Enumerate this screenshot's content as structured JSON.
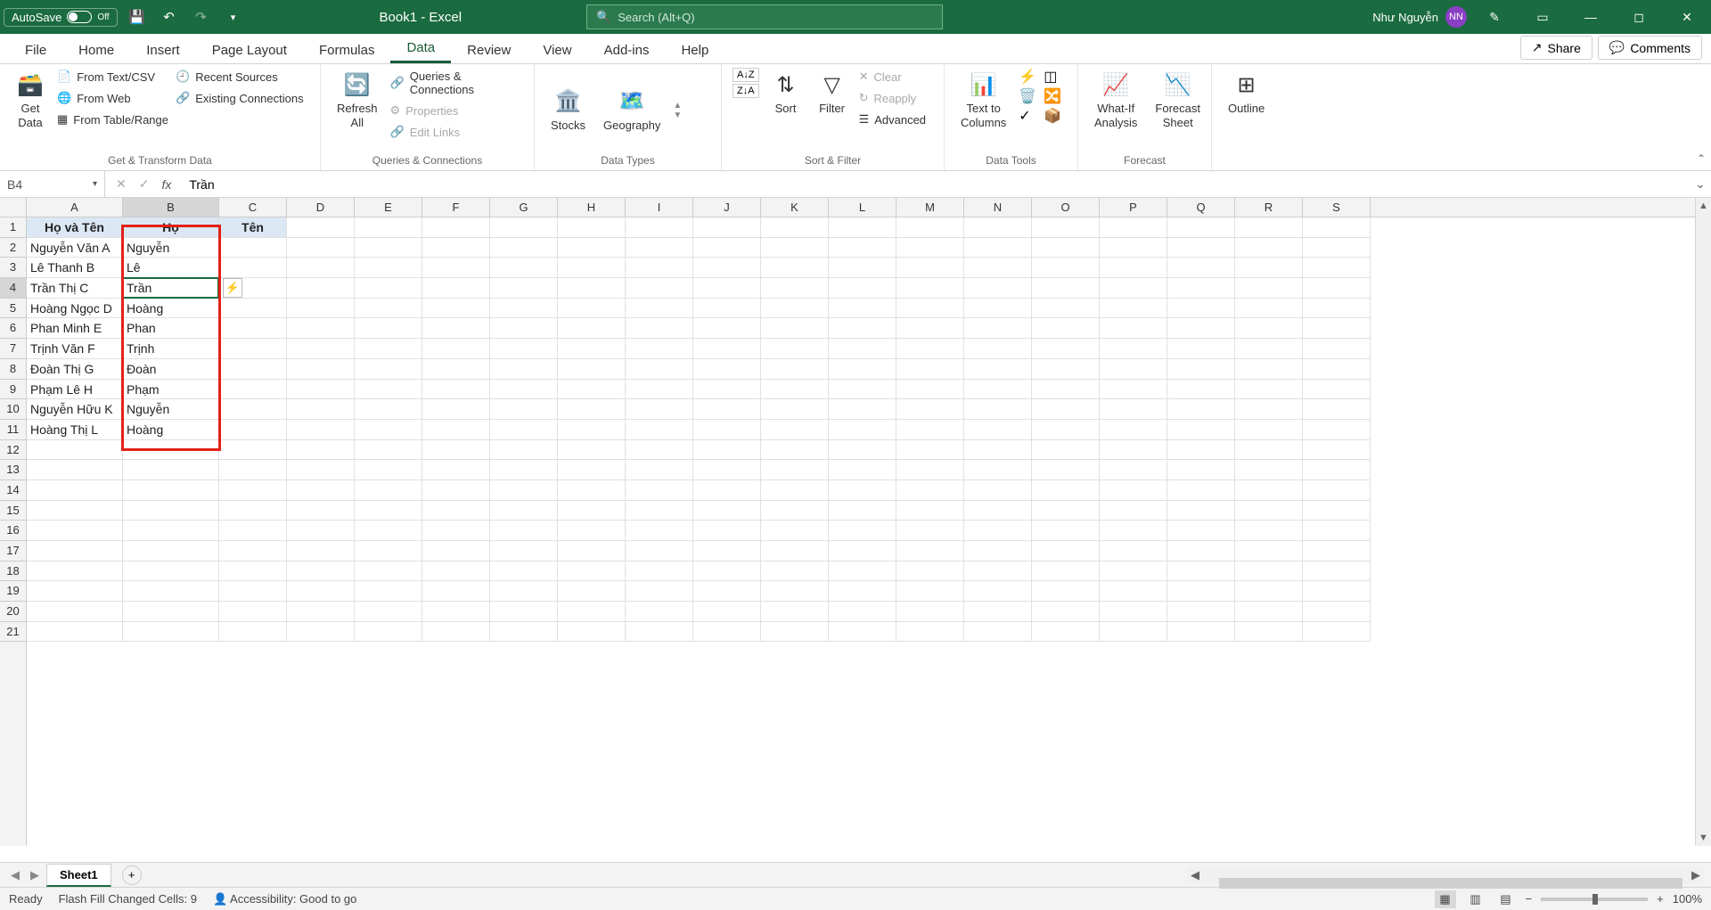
{
  "titlebar": {
    "autosave": "AutoSave",
    "autosave_state": "Off",
    "doc_title": "Book1  -  Excel",
    "search_placeholder": "Search (Alt+Q)",
    "user_name": "Như Nguyễn",
    "user_initials": "NN"
  },
  "tabs": {
    "items": [
      "File",
      "Home",
      "Insert",
      "Page Layout",
      "Formulas",
      "Data",
      "Review",
      "View",
      "Add-ins",
      "Help"
    ],
    "active_index": 5,
    "share": "Share",
    "comments": "Comments"
  },
  "ribbon": {
    "get_data": {
      "big": "Get\nData",
      "items": [
        "From Text/CSV",
        "From Web",
        "From Table/Range",
        "Recent Sources",
        "Existing Connections"
      ],
      "group": "Get & Transform Data"
    },
    "queries": {
      "big": "Refresh\nAll",
      "items": [
        "Queries & Connections",
        "Properties",
        "Edit Links"
      ],
      "group": "Queries & Connections"
    },
    "datatypes": {
      "stocks": "Stocks",
      "geography": "Geography",
      "group": "Data Types"
    },
    "sortfilter": {
      "sort": "Sort",
      "filter": "Filter",
      "clear": "Clear",
      "reapply": "Reapply",
      "advanced": "Advanced",
      "group": "Sort & Filter"
    },
    "datatools": {
      "ttc": "Text to\nColumns",
      "group": "Data Tools"
    },
    "forecast": {
      "whatif": "What-If\nAnalysis",
      "sheet": "Forecast\nSheet",
      "group": "Forecast"
    },
    "outline": {
      "label": "Outline"
    }
  },
  "formula": {
    "namebox": "B4",
    "value": "Trần"
  },
  "grid": {
    "col_widths": {
      "A": 108,
      "B": 108,
      "C": 76,
      "other": 76
    },
    "col_letters": [
      "A",
      "B",
      "C",
      "D",
      "E",
      "F",
      "G",
      "H",
      "I",
      "J",
      "K",
      "L",
      "M",
      "N",
      "O",
      "P",
      "Q",
      "R",
      "S"
    ],
    "active_cell": "B4",
    "headers": [
      "Họ và Tên",
      "Họ",
      "Tên"
    ],
    "rows": [
      [
        "Nguyễn Văn A",
        "Nguyễn",
        ""
      ],
      [
        "Lê Thanh B",
        "Lê",
        ""
      ],
      [
        "Trần Thị C",
        "Trần",
        ""
      ],
      [
        "Hoàng Ngọc D",
        "Hoàng",
        ""
      ],
      [
        "Phan Minh E",
        "Phan",
        ""
      ],
      [
        "Trịnh Văn F",
        "Trịnh",
        ""
      ],
      [
        "Đoàn Thị G",
        "Đoàn",
        ""
      ],
      [
        "Phạm Lê H",
        "Phạm",
        ""
      ],
      [
        "Nguyễn Hữu K",
        "Nguyễn",
        ""
      ],
      [
        "Hoàng Thị L",
        "Hoàng",
        ""
      ]
    ],
    "total_rows": 21
  },
  "sheets": {
    "active": "Sheet1"
  },
  "status": {
    "ready": "Ready",
    "flash": "Flash Fill Changed Cells: 9",
    "access": "Accessibility: Good to go",
    "zoom": "100%"
  }
}
